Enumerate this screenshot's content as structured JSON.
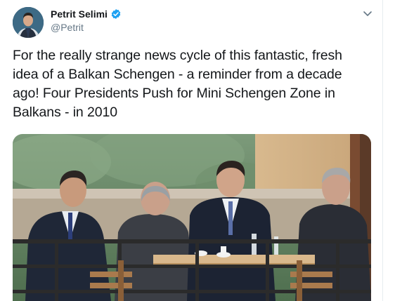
{
  "tweet": {
    "author": {
      "display_name": "Petrit Selimi",
      "handle": "@Petrit",
      "verified": true,
      "avatar_icon": "avatar-photo",
      "verified_icon": "verified-badge-icon"
    },
    "text": "For the really strange news cycle of this fantastic, fresh idea of a Balkan Schengen - a reminder from a decade ago! Four Presidents Push for Mini Schengen Zone in Balkans - in 2010",
    "menu_icon": "chevron-down-icon",
    "media": {
      "type": "photo",
      "icon": "embedded-photo"
    }
  },
  "colors": {
    "text_primary": "#14171a",
    "text_secondary": "#657786",
    "verified_blue": "#1da1f2",
    "divider": "#e6ecf0"
  }
}
